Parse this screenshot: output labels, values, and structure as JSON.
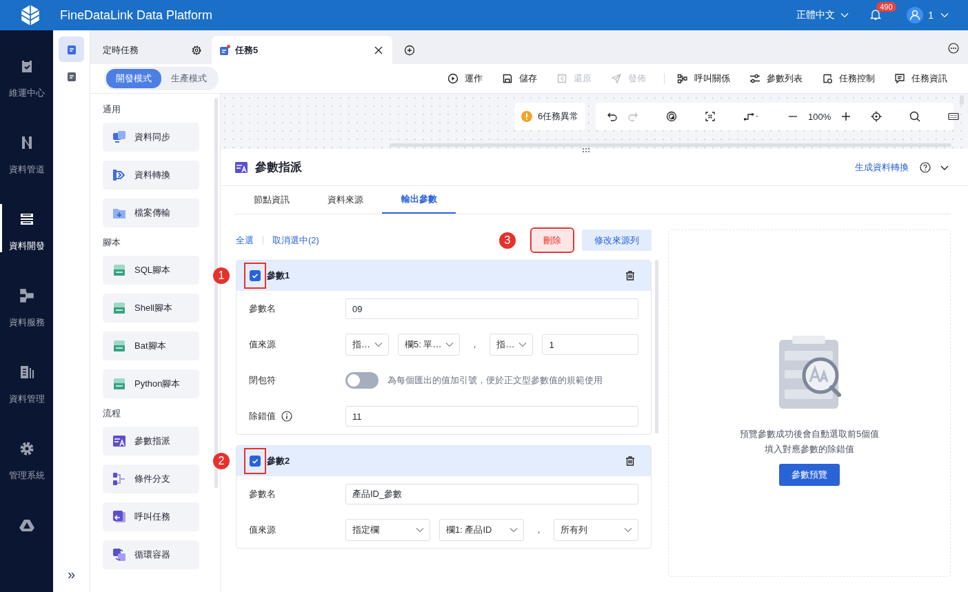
{
  "header": {
    "title": "FineDataLink Data Platform",
    "language": "正體中文",
    "notification_count": "490",
    "user": "1"
  },
  "nav": {
    "items": [
      {
        "label": "維運中心",
        "kind": "ops",
        "selected": false
      },
      {
        "label": "資料管道",
        "kind": "pipe",
        "selected": false
      },
      {
        "label": "資料開發",
        "kind": "dev",
        "selected": true
      },
      {
        "label": "資料服務",
        "kind": "service",
        "selected": false
      },
      {
        "label": "資料管理",
        "kind": "manage",
        "selected": false
      },
      {
        "label": "管理系統",
        "kind": "system",
        "selected": false
      },
      {
        "kind": "drive",
        "selected": false
      }
    ],
    "expand": "»"
  },
  "subnav": [
    {
      "kind": "task",
      "selected": true
    },
    {
      "kind": "doc",
      "selected": false
    }
  ],
  "tabs": [
    {
      "label": "定時任務",
      "kind": "folder",
      "selected": false
    },
    {
      "label": "任務5",
      "kind": "task",
      "selected": true,
      "modified": true
    }
  ],
  "modes": [
    {
      "label": "開發模式",
      "selected": true
    },
    {
      "label": "生產模式",
      "selected": false
    }
  ],
  "toolbar": [
    {
      "items": [
        {
          "label": "運作",
          "kind": "run",
          "disabled": false
        },
        {
          "label": "儲存",
          "kind": "save",
          "disabled": false
        },
        {
          "label": "還原",
          "kind": "revert",
          "disabled": true
        },
        {
          "label": "發佈",
          "kind": "publish",
          "disabled": true
        }
      ]
    },
    {
      "items": [
        {
          "label": "呼叫關係",
          "kind": "relation",
          "disabled": false
        },
        {
          "label": "參數列表",
          "kind": "sliders",
          "disabled": false
        },
        {
          "label": "任務控制",
          "kind": "control",
          "disabled": false
        },
        {
          "label": "任務資訊",
          "kind": "info",
          "disabled": false
        }
      ]
    }
  ],
  "palette": [
    {
      "title": "通用",
      "items": [
        {
          "label": "資料同步",
          "kind": "sync"
        },
        {
          "label": "資料轉換",
          "kind": "transform"
        },
        {
          "label": "檔案傳輸",
          "kind": "file"
        }
      ]
    },
    {
      "title": "腳本",
      "items": [
        {
          "label": "SQL腳本",
          "kind": "script"
        },
        {
          "label": "Shell腳本",
          "kind": "script"
        },
        {
          "label": "Bat腳本",
          "kind": "script"
        },
        {
          "label": "Python腳本",
          "kind": "script"
        }
      ]
    },
    {
      "title": "流程",
      "items": [
        {
          "label": "參數指派",
          "kind": "param"
        },
        {
          "label": "條件分支",
          "kind": "branch"
        },
        {
          "label": "呼叫任務",
          "kind": "call"
        },
        {
          "label": "循環容器",
          "kind": "loop"
        }
      ]
    }
  ],
  "canvas": {
    "alert": "6任務異常",
    "zoom": "100%"
  },
  "panel": {
    "title": "參數指派",
    "link": "生成資料轉換",
    "tabs": [
      {
        "label": "節點資訊",
        "selected": false
      },
      {
        "label": "資料來源",
        "selected": false
      },
      {
        "label": "輸出參數",
        "selected": true
      }
    ],
    "select_all": "全選",
    "deselect": "取消選中(2)",
    "delete": {
      "label": "刪除",
      "step": "3"
    },
    "edit_source": "修改來源列",
    "params": [
      {
        "title": "參數1",
        "checked": true,
        "step": "1",
        "fields": [
          {
            "label": "參數名",
            "kind": "text",
            "value": "09",
            "info": false
          },
          {
            "label": "值來源",
            "kind": "source",
            "info": false,
            "parts": [
              {
                "kind": "select",
                "value": "指…"
              },
              {
                "kind": "select",
                "value": "欄5: 單…"
              },
              {
                "kind": "separator",
                "value": "，"
              },
              {
                "kind": "select",
                "value": "指…"
              },
              {
                "kind": "input",
                "value": "1"
              }
            ]
          },
          {
            "label": "閉包符",
            "kind": "toggle",
            "on": false,
            "info": false,
            "hint": "為每個匯出的值加引號，便於正文型參數值的規範使用"
          },
          {
            "label": "除錯值",
            "kind": "text",
            "value": "11",
            "info": true
          }
        ]
      },
      {
        "title": "參數2",
        "checked": true,
        "step": "2",
        "fields": [
          {
            "label": "參數名",
            "kind": "text",
            "value": "產品ID_參數",
            "info": false
          },
          {
            "label": "值來源",
            "kind": "source",
            "info": false,
            "parts": [
              {
                "kind": "select",
                "value": "指定欄"
              },
              {
                "kind": "select",
                "value": "欄1: 產品ID"
              },
              {
                "kind": "separator",
                "value": "，"
              },
              {
                "kind": "select",
                "value": "所有列"
              }
            ]
          }
        ]
      }
    ],
    "preview": {
      "lines": [
        "預覽參數成功後會自動選取前5個值",
        "填入對應參數的除錯值"
      ],
      "button": "參數預覽"
    }
  }
}
